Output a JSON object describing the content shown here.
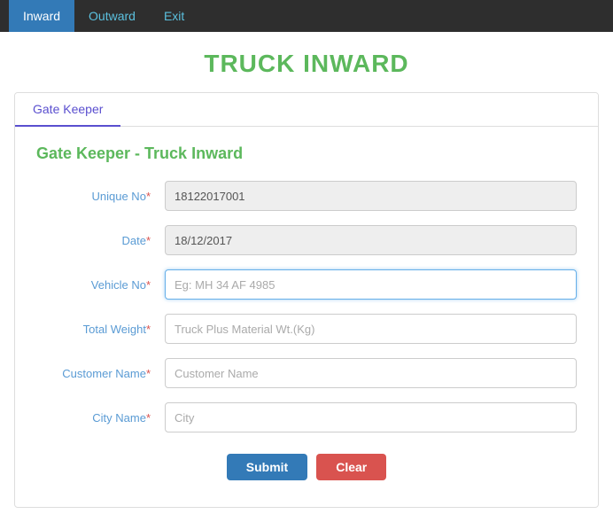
{
  "navbar": {
    "items": [
      {
        "label": "Inward",
        "active": true
      },
      {
        "label": "Outward",
        "active": false
      },
      {
        "label": "Exit",
        "active": false
      }
    ]
  },
  "page": {
    "title": "TRUCK INWARD"
  },
  "tab": {
    "label": "Gate Keeper"
  },
  "section": {
    "title": "Gate Keeper - Truck Inward"
  },
  "form": {
    "fields": [
      {
        "label": "Unique No",
        "required": true,
        "value": "18122017001",
        "placeholder": "",
        "readonly": true,
        "id": "unique-no"
      },
      {
        "label": "Date",
        "required": true,
        "value": "18/12/2017",
        "placeholder": "",
        "readonly": true,
        "id": "date"
      },
      {
        "label": "Vehicle No",
        "required": true,
        "value": "",
        "placeholder": "Eg: MH 34 AF 4985",
        "readonly": false,
        "id": "vehicle-no"
      },
      {
        "label": "Total Weight",
        "required": true,
        "value": "",
        "placeholder": "Truck Plus Material Wt.(Kg)",
        "readonly": false,
        "id": "total-weight"
      },
      {
        "label": "Customer Name",
        "required": true,
        "value": "",
        "placeholder": "Customer Name",
        "readonly": false,
        "id": "customer-name"
      },
      {
        "label": "City Name",
        "required": true,
        "value": "",
        "placeholder": "City",
        "readonly": false,
        "id": "city-name"
      }
    ],
    "buttons": {
      "submit": "Submit",
      "clear": "Clear"
    }
  }
}
